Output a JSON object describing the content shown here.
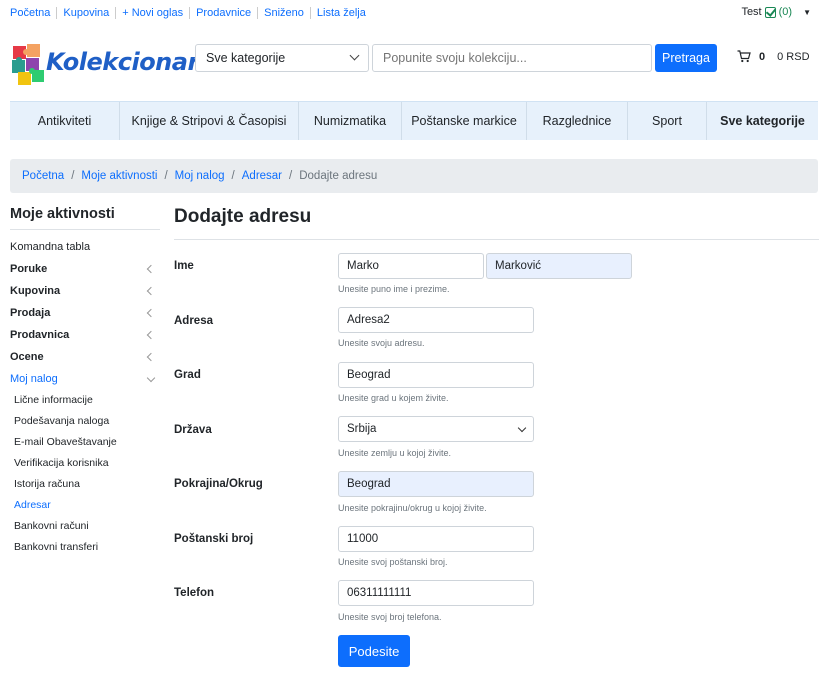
{
  "topbar": {
    "links": [
      "Početna",
      "Kupovina",
      "+ Novi oglas",
      "Prodavnice",
      "Sniženo",
      "Lista želja"
    ],
    "user": "Test",
    "user_count": "(0)"
  },
  "header": {
    "logo_text": "Kolekcionari",
    "category_select": "Sve kategorije",
    "search_placeholder": "Popunite svoju kolekciju...",
    "search_button": "Pretraga",
    "cart_count": "0",
    "cart_total": "0 RSD"
  },
  "catnav": [
    "Antikviteti",
    "Knjige & Stripovi & Časopisi",
    "Numizmatika",
    "Poštanske markice",
    "Razglednice",
    "Sport",
    "Sve kategorije"
  ],
  "breadcrumb": {
    "items": [
      "Početna",
      "Moje aktivnosti",
      "Moj nalog",
      "Adresar"
    ],
    "active": "Dodajte adresu"
  },
  "sidebar": {
    "title": "Moje aktivnosti",
    "dashboard": "Komandna tabla",
    "groups": [
      "Poruke",
      "Kupovina",
      "Prodaja",
      "Prodavnica",
      "Ocene"
    ],
    "open_group": "Moj nalog",
    "sub_items": [
      "Lične informacije",
      "Podešavanja naloga",
      "E-mail Obaveštavanje",
      "Verifikacija korisnika",
      "Istorija računa",
      "Adresar",
      "Bankovni računi",
      "Bankovni transferi"
    ]
  },
  "form": {
    "title": "Dodajte adresu",
    "name": {
      "label": "Ime",
      "first": "Marko",
      "last": "Marković",
      "help": "Unesite puno ime i prezime."
    },
    "address": {
      "label": "Adresa",
      "value": "Adresa2",
      "help": "Unesite svoju adresu."
    },
    "city": {
      "label": "Grad",
      "value": "Beograd",
      "help": "Unesite grad u kojem živite."
    },
    "country": {
      "label": "Država",
      "value": "Srbija",
      "help": "Unesite zemlju u kojoj živite."
    },
    "region": {
      "label": "Pokrajina/Okrug",
      "value": "Beograd",
      "help": "Unesite pokrajinu/okrug u kojoj živite."
    },
    "zip": {
      "label": "Poštanski broj",
      "value": "11000",
      "help": "Unesite svoj poštanski broj."
    },
    "phone": {
      "label": "Telefon",
      "value": "06311111111",
      "help": "Unesite svoj broj telefona."
    },
    "submit": "Podesite"
  },
  "colors": {
    "primary": "#0d6efd",
    "nav_bg": "#e7f1fb",
    "autofill": "#e8f0fe"
  }
}
